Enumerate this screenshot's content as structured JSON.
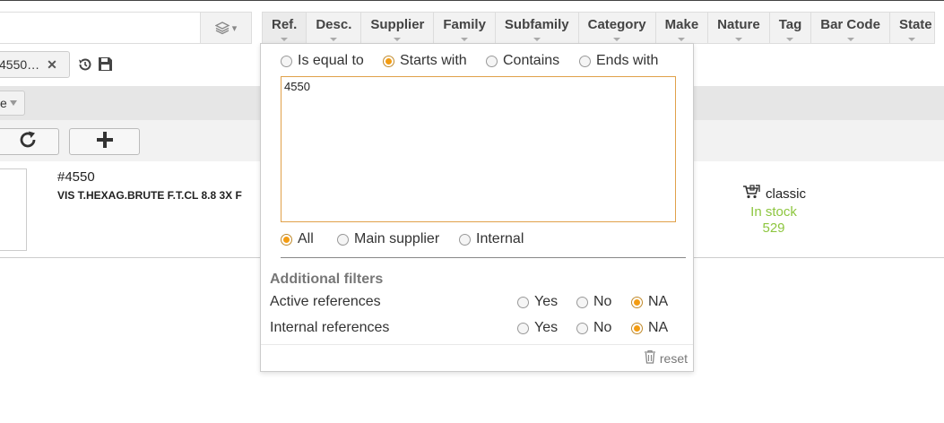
{
  "toolbar": {
    "search_value": ""
  },
  "tabs": [
    {
      "label": "Ref.",
      "active": true
    },
    {
      "label": "Desc.",
      "active": false
    },
    {
      "label": "Supplier",
      "active": false
    },
    {
      "label": "Family",
      "active": false
    },
    {
      "label": "Subfamily",
      "active": false
    },
    {
      "label": "Category",
      "active": false
    },
    {
      "label": "Make",
      "active": false
    },
    {
      "label": "Nature",
      "active": false
    },
    {
      "label": "Tag",
      "active": false
    },
    {
      "label": "Bar Code",
      "active": false
    },
    {
      "label": "State",
      "active": false
    }
  ],
  "chip": {
    "label": "4550…",
    "close": "✕"
  },
  "selector": {
    "value": "e"
  },
  "product": {
    "ref": "#4550",
    "description": "VIS T.HEXAG.BRUTE F.T.CL 8.8 3X F",
    "nature": "classic",
    "stock_status": "In stock",
    "stock_qty": "529"
  },
  "popup": {
    "match_modes": [
      {
        "label": "Is equal to",
        "checked": false
      },
      {
        "label": "Starts with",
        "checked": true
      },
      {
        "label": "Contains",
        "checked": false
      },
      {
        "label": "Ends with",
        "checked": false
      }
    ],
    "query": "4550",
    "scope": [
      {
        "label": "All",
        "checked": true
      },
      {
        "label": "Main supplier",
        "checked": false
      },
      {
        "label": "Internal",
        "checked": false
      }
    ],
    "additional_title": "Additional filters",
    "filters": [
      {
        "label": "Active references",
        "yes": "Yes",
        "no": "No",
        "na": "NA",
        "selected": "na"
      },
      {
        "label": "Internal references",
        "yes": "Yes",
        "no": "No",
        "na": "NA",
        "selected": "na"
      }
    ],
    "reset_label": "reset"
  },
  "colors": {
    "accent": "#f39c12",
    "stock": "#8dc63f",
    "border": "#dddddd"
  }
}
